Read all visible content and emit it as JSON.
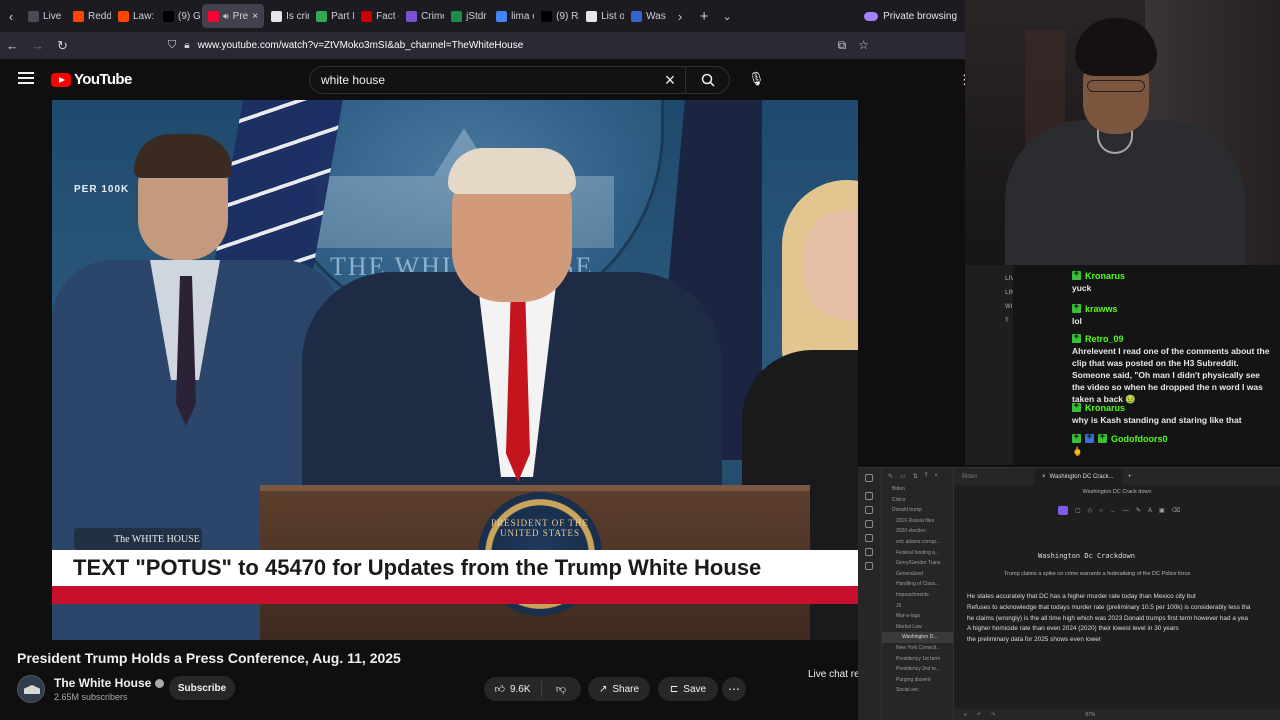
{
  "browser": {
    "tabs": [
      {
        "label": "Live",
        "color": "#4a4a55"
      },
      {
        "label": "Reddi",
        "color": "#ff4500"
      },
      {
        "label": "Law: C",
        "color": "#ff4500"
      },
      {
        "label": "(9) Gr",
        "color": "#000000"
      },
      {
        "label": "Pre",
        "color": "#ff0033",
        "active": true
      },
      {
        "label": "Is crir",
        "color": "#e6e6e6"
      },
      {
        "label": "Part I",
        "color": "#34a853"
      },
      {
        "label": "Fact c",
        "color": "#cc0000"
      },
      {
        "label": "Crime",
        "color": "#7b4fd6"
      },
      {
        "label": "jStdr",
        "color": "#1c8f4a"
      },
      {
        "label": "lima c",
        "color": "#4285f4"
      },
      {
        "label": "(9) Ra",
        "color": "#000000"
      },
      {
        "label": "List of",
        "color": "#e6e6e6"
      },
      {
        "label": "Was",
        "color": "#3366cc"
      }
    ],
    "private_label": "Private browsing",
    "url": "www.youtube.com/watch?v=ZtVMoko3mSI&ab_channel=TheWhiteHouse"
  },
  "youtube": {
    "logo": "YouTube",
    "search_query": "white house",
    "video": {
      "overlay_per": "PER 100K",
      "seal_text": "THE WHITE HOUSE",
      "logo_text": "The WHITE HOUSE",
      "podium_text": "PRESIDENT OF THE UNITED STATES",
      "banner": "TEXT \"POTUS\" to 45470 for Updates from the Trump White House"
    },
    "title": "President Trump Holds a Press Conference, Aug. 11, 2025",
    "channel": "The White House",
    "subscribers": "2.65M subscribers",
    "subscribe_label": "Subscribe",
    "likes": "9.6K",
    "share_label": "Share",
    "save_label": "Save",
    "live_chat_label": "Live chat re"
  },
  "chat": {
    "side_strip": "LIV LIN WI T"
  },
  "chat_messages": [
    {
      "user": "Kronarus",
      "text": "yuck",
      "badges": [
        "green"
      ]
    },
    {
      "user": "krawws",
      "text": "lol",
      "badges": [
        "green"
      ]
    },
    {
      "user": "Retro_09",
      "text": "Ahrelevent I read one of the comments about the clip that was posted on the H3 Subreddit. Someone said, \"Oh man I didn't physically see the video so when he dropped the n word I was taken a back 🤢",
      "badges": [
        "green"
      ]
    },
    {
      "user": "Kronarus",
      "text": "why is Kash standing and staring like that",
      "badges": [
        "green"
      ]
    },
    {
      "user": "Godofdoors0",
      "text": "🖕",
      "badges": [
        "green",
        "blue",
        "green"
      ]
    }
  ],
  "notes": {
    "tree_items": [
      "Biden",
      "Civics",
      "Donald trump",
      "2016 Russia files",
      "2020 election",
      "eric adams corrup...",
      "Federal funding a...",
      "Gerry/Gender Trans",
      "Generalized",
      "Handling of Class...",
      "Impeachments",
      "J6",
      "Mar-a-lago",
      "Martial Law",
      "Washington D...",
      "New York Convicti...",
      "Presidency 1st term",
      "Presidency 2nd te...",
      "Purging dissent",
      "Social sec"
    ],
    "tab_dim": "Biden",
    "tab": "Washington DC Crack...",
    "breadcrumb": "Washington DC Crack down",
    "title": "Washington Dc Crackdown",
    "subtitle": "Trump claims a spike on crime warrants a federalising of the DC Police force",
    "lines": [
      "He states accurately that DC has a higher murder rate today than Mexico city but",
      "Refuses to acknowledge that todays murder rate (preliminary 10.5 per 100k)  is considerably less tha",
      "he claims (wrongly) is the all time high which was 2023  Donald trumps first term however had a yea",
      "A higher homicide rate than even 2024 (2020) their lowest level in 30 years",
      "the preliminary data for 2025 shows even lower"
    ],
    "zoom": "87%"
  }
}
